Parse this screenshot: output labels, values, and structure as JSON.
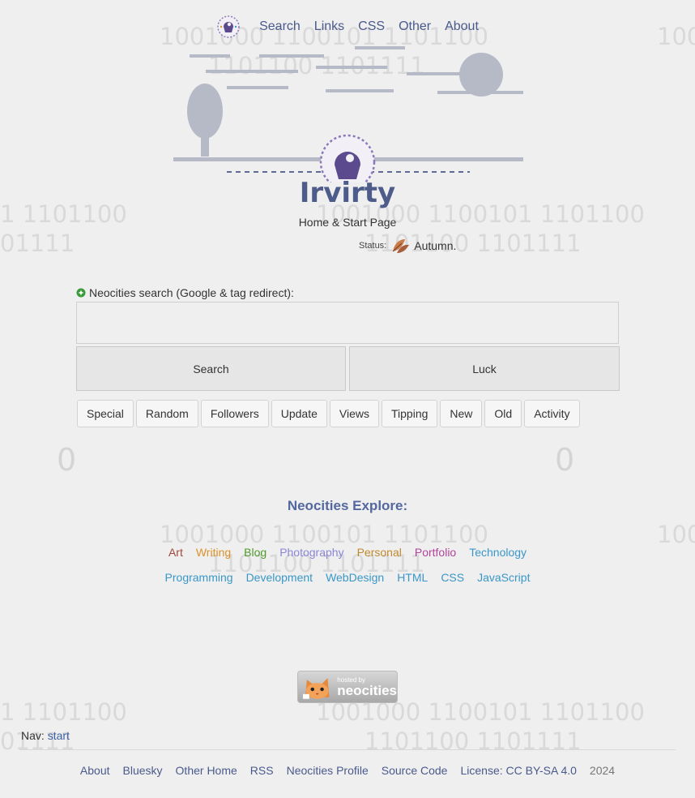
{
  "background": {
    "binary_line_1": "1001000 1100101 1101100",
    "binary_line_2": "1101100 1101111",
    "binary_left_1": "1 1101100",
    "binary_left_2": "01111",
    "binary_edge": "100",
    "zero": "0"
  },
  "topnav": {
    "items": [
      {
        "label": "Search"
      },
      {
        "label": "Links"
      },
      {
        "label": "CSS"
      },
      {
        "label": "Other"
      },
      {
        "label": "About"
      }
    ]
  },
  "header": {
    "title": "Irvirty",
    "subtitle": "Home & Start Page",
    "status_label": "Status:",
    "status_value": "Autumn."
  },
  "search": {
    "label": "Neocities search (Google & tag redirect):",
    "placeholder": "",
    "search_button": "Search",
    "luck_button": "Luck"
  },
  "quick_buttons": [
    "Special",
    "Random",
    "Followers",
    "Update",
    "Views",
    "Tipping",
    "New",
    "Old",
    "Activity"
  ],
  "explore": {
    "title": "Neocities Explore:",
    "row1": [
      {
        "label": "Art",
        "color": "#a0483c"
      },
      {
        "label": "Writing",
        "color": "#d9932a"
      },
      {
        "label": "Blog",
        "color": "#4f9a2c"
      },
      {
        "label": "Photography",
        "color": "#8a86d6"
      },
      {
        "label": "Personal",
        "color": "#c08a2c"
      },
      {
        "label": "Portfolio",
        "color": "#b0449a"
      },
      {
        "label": "Technology",
        "color": "#3a97c8"
      }
    ],
    "row2": [
      {
        "label": "Programming",
        "color": "#3a97c8"
      },
      {
        "label": "Development",
        "color": "#3a97c8"
      },
      {
        "label": "WebDesign",
        "color": "#3a97c8"
      },
      {
        "label": "HTML",
        "color": "#3a97c8"
      },
      {
        "label": "CSS",
        "color": "#3a97c8"
      },
      {
        "label": "JavaScript",
        "color": "#3a97c8"
      }
    ]
  },
  "badge": {
    "small": "hosted by",
    "big": "neocities"
  },
  "nav": {
    "label": "Nav:",
    "link": "start"
  },
  "footer": {
    "links": [
      {
        "label": "About"
      },
      {
        "label": "Bluesky"
      },
      {
        "label": "Other Home"
      },
      {
        "label": "RSS"
      },
      {
        "label": "Neocities Profile"
      },
      {
        "label": "Source Code"
      },
      {
        "label": "License: CC BY-SA 4.0"
      }
    ],
    "year": "2024"
  },
  "colors": {
    "accent": "#4d5c8a",
    "link": "#4a5a8c",
    "background": "#efefef"
  }
}
